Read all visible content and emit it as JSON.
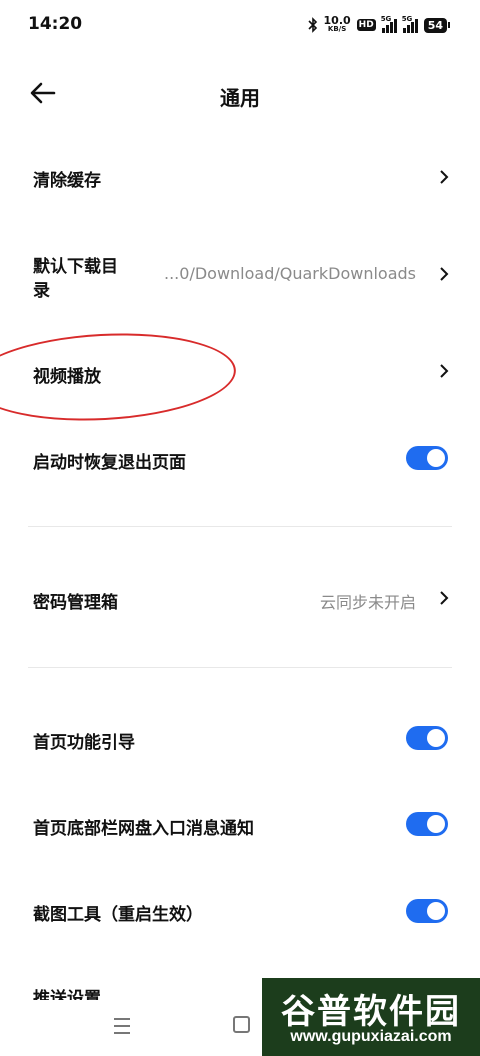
{
  "status_bar": {
    "time": "14:20",
    "net_speed": "10.0",
    "net_unit": "KB/S",
    "hd_badge": "HD",
    "sim1_label": "5G",
    "sim2_label": "5G",
    "battery": "54"
  },
  "header": {
    "title": "通用"
  },
  "settings": {
    "clear_cache": {
      "label": "清除缓存"
    },
    "download_dir": {
      "label_line1": "默认下载目",
      "label_line2": "录",
      "value": "...0/Download/QuarkDownloads"
    },
    "video_play": {
      "label": "视频播放"
    },
    "restore_pages": {
      "label": "启动时恢复退出页面",
      "enabled": true
    },
    "password_box": {
      "label": "密码管理箱",
      "value": "云同步未开启"
    },
    "home_guide": {
      "label": "首页功能引导",
      "enabled": true
    },
    "netdisk_notify": {
      "label": "首页底部栏网盘入口消息通知",
      "enabled": true
    },
    "screenshot_tool": {
      "label": "截图工具（重启生效）",
      "enabled": true
    },
    "push_settings": {
      "label": "推送设置"
    }
  },
  "annotation": {
    "color": "#d82b2b"
  },
  "colors": {
    "accent": "#1f6cf0"
  },
  "watermark": {
    "title": "谷普软件园",
    "url": "www.gupuxiazai.com"
  }
}
